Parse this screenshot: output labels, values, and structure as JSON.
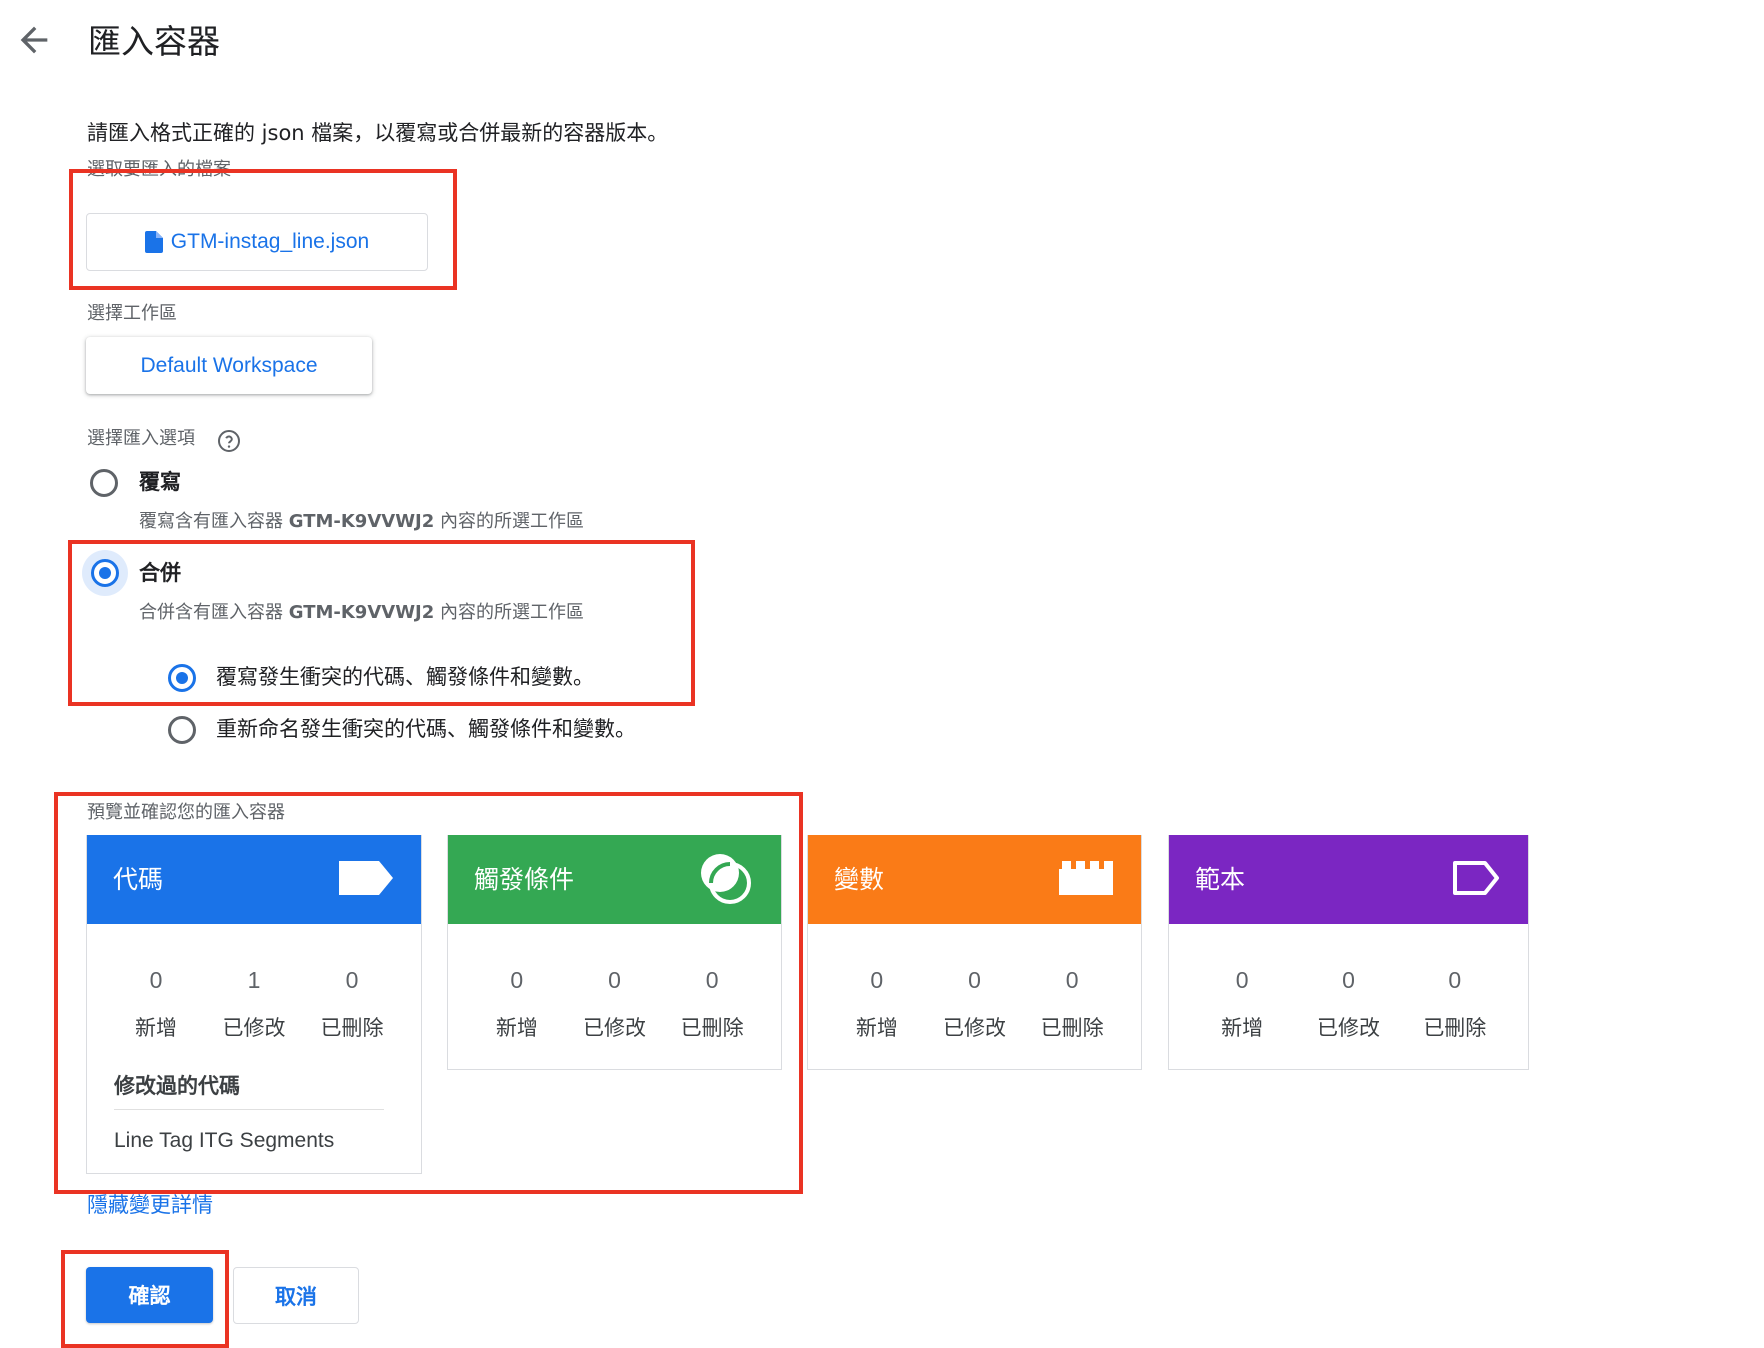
{
  "header": {
    "back_icon": "arrow-left-icon",
    "title": "匯入容器"
  },
  "intro": "請匯入格式正確的 json 檔案，以覆寫或合併最新的容器版本。",
  "file_section": {
    "label": "選取要匯入的檔案",
    "file_icon": "file-icon",
    "file_name": "GTM-instag_line.json"
  },
  "workspace_section": {
    "label": "選擇工作區",
    "workspace": "Default Workspace"
  },
  "import_options": {
    "label": "選擇匯入選項",
    "help_icon": "help-icon",
    "overwrite": {
      "title": "覆寫",
      "desc_prefix": "覆寫含有匯入容器 ",
      "container_id": "GTM-K9VVWJ2",
      "desc_suffix": " 內容的所選工作區",
      "selected": false
    },
    "merge": {
      "title": "合併",
      "desc_prefix": "合併含有匯入容器 ",
      "container_id": "GTM-K9VVWJ2",
      "desc_suffix": " 內容的所選工作區",
      "selected": true
    },
    "merge_sub": [
      {
        "label": "覆寫發生衝突的代碼、觸發條件和變數。",
        "selected": true
      },
      {
        "label": "重新命名發生衝突的代碼、觸發條件和變數。",
        "selected": false
      }
    ]
  },
  "preview": {
    "label": "預覽並確認您的匯入容器",
    "cards": [
      {
        "title": "代碼",
        "icon": "tag-icon",
        "color": "#1a73e8",
        "new": "0",
        "modified": "1",
        "deleted": "0",
        "new_label": "新增",
        "modified_label": "已修改",
        "deleted_label": "已刪除",
        "modified_heading": "修改過的代碼",
        "modified_items": [
          "Line Tag ITG Segments"
        ]
      },
      {
        "title": "觸發條件",
        "icon": "trigger-icon",
        "color": "#34a853",
        "new": "0",
        "modified": "0",
        "deleted": "0",
        "new_label": "新增",
        "modified_label": "已修改",
        "deleted_label": "已刪除"
      },
      {
        "title": "變數",
        "icon": "variable-brick-icon",
        "color": "#fa7b17",
        "new": "0",
        "modified": "0",
        "deleted": "0",
        "new_label": "新增",
        "modified_label": "已修改",
        "deleted_label": "已刪除"
      },
      {
        "title": "範本",
        "icon": "template-tag-outline-icon",
        "color": "#7b26c2",
        "new": "0",
        "modified": "0",
        "deleted": "0",
        "new_label": "新增",
        "modified_label": "已修改",
        "deleted_label": "已刪除"
      }
    ]
  },
  "hide_details_link": "隱藏變更詳情",
  "actions": {
    "confirm": "確認",
    "cancel": "取消"
  },
  "colors": {
    "accent": "#1a73e8",
    "highlight": "#ea3323"
  }
}
